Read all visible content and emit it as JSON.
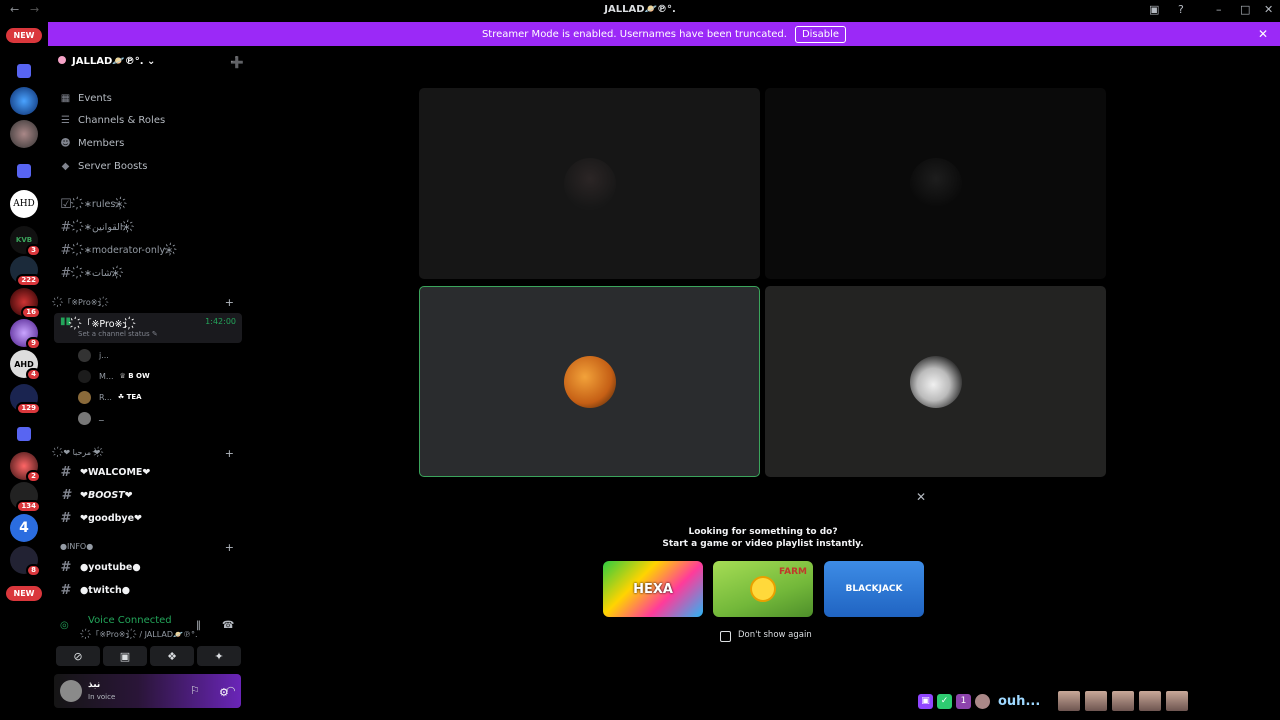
{
  "titlebar": {
    "back_icon": "arrow-left",
    "forward_icon": "arrow-right",
    "title": "JALLAD🪐℗°.",
    "icons": [
      "inbox-icon",
      "help-icon",
      "minimize-icon",
      "maximize-icon",
      "close-icon"
    ],
    "icon_glyphs": [
      "▣",
      "?",
      "–",
      "□",
      "✕"
    ]
  },
  "banner": {
    "text": "Streamer Mode is enabled. Usernames have been truncated.",
    "button_label": "Disable",
    "close_glyph": "✕",
    "color": "#9b29f7"
  },
  "servers": {
    "new_top": "NEW",
    "new_bottom": "NEW",
    "ahd_label": "AHD",
    "ahd2_label": "AHD",
    "kvb_label": "KVB",
    "badges": [
      "3",
      "222",
      "16",
      "9",
      "4",
      "129",
      "2",
      "134",
      "8"
    ]
  },
  "sidebar": {
    "server_name": "JALLAD🪐℗°.",
    "chevron": "⌄",
    "add_member_glyph": "➕",
    "nav": [
      {
        "label": "Events",
        "icon": "calendar-icon",
        "glyph": "▦"
      },
      {
        "label": "Channels & Roles",
        "icon": "list-icon",
        "glyph": "☰"
      },
      {
        "label": "Members",
        "icon": "members-icon",
        "glyph": "☻"
      },
      {
        "label": "Server Boosts",
        "icon": "boost-icon",
        "glyph": "◆"
      }
    ],
    "text_channels": [
      {
        "name": "҉∗rules∗҉",
        "glyph": "☑"
      },
      {
        "name": "҉∗القوانين∗҉",
        "glyph": "#"
      },
      {
        "name": "҉∗moderator-only∗҉",
        "glyph": "#"
      },
      {
        "name": "҉∗شات∗҉",
        "glyph": "#"
      }
    ],
    "voice_category": "҉「※Pro※」҉",
    "voice_channel": {
      "name": "҉「※Pro※」҉",
      "time": "1:42:00",
      "status": "Set a channel status ✎"
    },
    "voice_users": [
      {
        "name": "j...",
        "tag": ""
      },
      {
        "name": "M...",
        "tag": "♕ B OW"
      },
      {
        "name": "R...",
        "tag": "☘ TEA"
      },
      {
        "name": "ــ",
        "tag": ""
      }
    ],
    "welcome_category": "҉❤ مرحبا ❤҉",
    "welcome_channels": [
      {
        "name": "❤WALCOME❤"
      },
      {
        "name": "❤BOOST❤"
      },
      {
        "name": "❤goodbye❤"
      }
    ],
    "info_category": "●INFO●",
    "info_channels": [
      {
        "name": "●youtube●"
      },
      {
        "name": "●twitch●"
      }
    ],
    "plus_glyph": "+"
  },
  "connection": {
    "title": "Voice Connected",
    "subtitle": "҉「※Pro※」҉ / JALLAD🪐℗°.",
    "signal_glyph": "◎",
    "noise_glyph": "‖",
    "disconnect_glyph": "☎",
    "buttons": [
      {
        "icon": "camera-off-icon",
        "glyph": "⊘"
      },
      {
        "icon": "screen-share-icon",
        "glyph": "▣"
      },
      {
        "icon": "activities-icon",
        "glyph": "❖"
      },
      {
        "icon": "soundboard-icon",
        "glyph": "✦"
      }
    ]
  },
  "user_panel": {
    "name": "نبذ",
    "status": "In voice",
    "mic_glyph": "⚐",
    "headphones_glyph": "◠",
    "settings_glyph": "⚙",
    "accent": "#6a25b8"
  },
  "stage": {
    "tiles": [
      "participant-1",
      "participant-2",
      "participant-3",
      "participant-4"
    ],
    "speaking_color": "#3ba55c"
  },
  "popup": {
    "line1": "Looking for something to do?",
    "line2": "Start a game or video playlist instantly.",
    "close_glyph": "✕",
    "games": [
      {
        "label": "HEXA"
      },
      {
        "label": "FARM"
      },
      {
        "label": "BLACKJACK"
      }
    ],
    "checkbox_label": "Don't show again"
  },
  "overlay": {
    "text": "ouh...",
    "icons": [
      "twitch-icon",
      "green-icon",
      "purple-icon",
      "avatar-icon"
    ]
  }
}
